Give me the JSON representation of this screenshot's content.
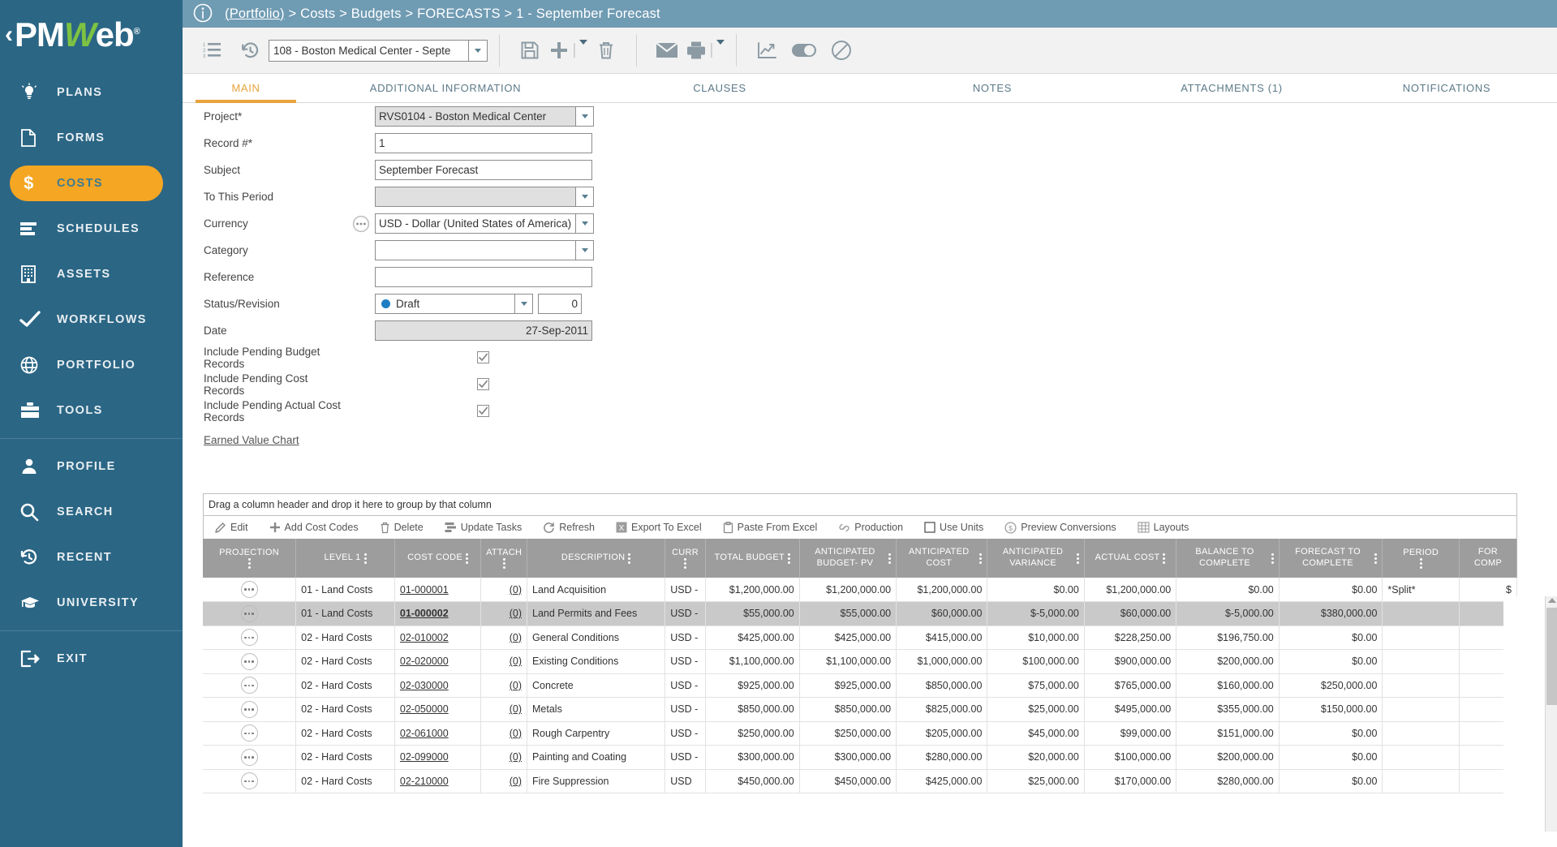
{
  "brand": {
    "chevron": "‹",
    "pm": "PM",
    "w": "W",
    "eb": "eb",
    "reg": "®"
  },
  "colors": {
    "sidebar": "#2b6685",
    "accent": "#f5a623",
    "topbar": "#6f9bb3",
    "brand_green": "#7dc242",
    "tab_active": "#e8a33d",
    "status_draft": "#1f7ec2"
  },
  "sidebar": {
    "items": [
      {
        "label": "PLANS",
        "icon": "lightbulb-icon",
        "active": false
      },
      {
        "label": "FORMS",
        "icon": "document-icon",
        "active": false
      },
      {
        "label": "COSTS",
        "icon": "dollar-icon",
        "active": true
      },
      {
        "label": "SCHEDULES",
        "icon": "bars-icon",
        "active": false
      },
      {
        "label": "ASSETS",
        "icon": "building-icon",
        "active": false
      },
      {
        "label": "WORKFLOWS",
        "icon": "checkmark-icon",
        "active": false
      },
      {
        "label": "PORTFOLIO",
        "icon": "globe-icon",
        "active": false
      },
      {
        "label": "TOOLS",
        "icon": "toolbox-icon",
        "active": false
      }
    ],
    "items2": [
      {
        "label": "PROFILE",
        "icon": "person-icon"
      },
      {
        "label": "SEARCH",
        "icon": "magnifier-icon"
      },
      {
        "label": "RECENT",
        "icon": "history-clock-icon"
      },
      {
        "label": "UNIVERSITY",
        "icon": "graduation-cap-icon"
      }
    ],
    "items3": [
      {
        "label": "EXIT",
        "icon": "exit-door-icon"
      }
    ]
  },
  "topbar": {
    "info_icon": "info-circle-icon",
    "breadcrumb_link": "(Portfolio)",
    "breadcrumb_rest": " > Costs > Budgets > FORECASTS > 1 - September Forecast"
  },
  "toolbar": {
    "list_icon": "numbered-list-icon",
    "history_icon": "history-clock-icon",
    "record_selector": "108 - Boston Medical Center - Septe",
    "save_icon": "save-disk-icon",
    "add_icon": "plus-icon",
    "add_caret": "add-dropdown-caret-icon",
    "delete_icon": "trash-icon",
    "email_icon": "envelope-icon",
    "print_icon": "printer-icon",
    "print_caret": "print-dropdown-caret-icon",
    "chart_icon": "line-chart-icon",
    "toggle_icon": "toggle-switch-icon",
    "block_icon": "no-entry-icon"
  },
  "tabs": [
    {
      "label": "MAIN",
      "active": true
    },
    {
      "label": "ADDITIONAL INFORMATION",
      "active": false
    },
    {
      "label": "CLAUSES",
      "active": false
    },
    {
      "label": "NOTES",
      "active": false
    },
    {
      "label": "ATTACHMENTS (1)",
      "active": false
    },
    {
      "label": "NOTIFICATIONS",
      "active": false
    }
  ],
  "form": {
    "project": {
      "label": "Project*",
      "value": "RVS0104 - Boston Medical Center"
    },
    "record": {
      "label": "Record #*",
      "value": "1"
    },
    "subject": {
      "label": "Subject",
      "value": "September Forecast"
    },
    "to_this_period": {
      "label": "To This Period",
      "value": ""
    },
    "currency": {
      "label": "Currency",
      "value": "USD - Dollar (United States of America)",
      "helper_icon": "ellipsis-circle-icon"
    },
    "category": {
      "label": "Category",
      "value": ""
    },
    "reference": {
      "label": "Reference",
      "value": ""
    },
    "status": {
      "label": "Status/Revision",
      "value": "Draft",
      "revision": "0"
    },
    "date": {
      "label": "Date",
      "value": "27-Sep-2011"
    },
    "chk_budget": {
      "label": "Include Pending Budget Records",
      "checked": true
    },
    "chk_cost": {
      "label": "Include Pending Cost Records",
      "checked": true
    },
    "chk_actual": {
      "label": "Include Pending Actual Cost Records",
      "checked": true
    },
    "evc_link": "Earned Value Chart",
    "check_glyph": "✓"
  },
  "grid": {
    "drag_hint": "Drag a column header and drop it here to group by that column",
    "tools": [
      {
        "label": "Edit",
        "icon": "pencil-icon"
      },
      {
        "label": "Add Cost Codes",
        "icon": "plus-icon"
      },
      {
        "label": "Delete",
        "icon": "trash-icon"
      },
      {
        "label": "Update Tasks",
        "icon": "tasks-icon"
      },
      {
        "label": "Refresh",
        "icon": "refresh-icon"
      },
      {
        "label": "Export To Excel",
        "icon": "excel-icon"
      },
      {
        "label": "Paste From Excel",
        "icon": "clipboard-icon"
      },
      {
        "label": "Production",
        "icon": "link-icon"
      },
      {
        "label": "Use Units",
        "icon": "checkbox-icon"
      },
      {
        "label": "Preview Conversions",
        "icon": "dollar-circle-icon"
      },
      {
        "label": "Layouts",
        "icon": "grid-layout-icon"
      }
    ],
    "columns": [
      "PROJECTION",
      "LEVEL 1",
      "COST CODE",
      "ATTACH",
      "DESCRIPTION",
      "CURR",
      "TOTAL BUDGET",
      "ANTICIPATED BUDGET- PV",
      "ANTICIPATED COST",
      "ANTICIPATED VARIANCE",
      "ACTUAL COST",
      "BALANCE TO COMPLETE",
      "FORECAST TO COMPLETE",
      "PERIOD",
      "FOR COMP"
    ],
    "rows": [
      {
        "projection": "⋯",
        "level1": "01 - Land Costs",
        "cost_code": "01-000001",
        "attach": "(0)",
        "description": "Land Acquisition",
        "curr": "USD -",
        "total_budget": "$1,200,000.00",
        "ant_budget_pv": "$1,200,000.00",
        "ant_cost": "$1,200,000.00",
        "ant_variance": "$0.00",
        "actual_cost": "$1,200,000.00",
        "balance_to_complete": "$0.00",
        "forecast_to_complete": "$0.00",
        "period": "*Split*",
        "for_comp": "$",
        "selected": false
      },
      {
        "projection": "⋯",
        "level1": "01 - Land Costs",
        "cost_code": "01-000002",
        "attach": "(0)",
        "description": "Land Permits and Fees",
        "curr": "USD -",
        "total_budget": "$55,000.00",
        "ant_budget_pv": "$55,000.00",
        "ant_cost": "$60,000.00",
        "ant_variance": "$-5,000.00",
        "actual_cost": "$60,000.00",
        "balance_to_complete": "$-5,000.00",
        "forecast_to_complete": "$380,000.00",
        "period": "",
        "for_comp": "",
        "selected": true
      },
      {
        "projection": "⋯",
        "level1": "02 - Hard Costs",
        "cost_code": "02-010002",
        "attach": "(0)",
        "description": "General Conditions",
        "curr": "USD -",
        "total_budget": "$425,000.00",
        "ant_budget_pv": "$425,000.00",
        "ant_cost": "$415,000.00",
        "ant_variance": "$10,000.00",
        "actual_cost": "$228,250.00",
        "balance_to_complete": "$196,750.00",
        "forecast_to_complete": "$0.00",
        "period": "",
        "for_comp": "",
        "selected": false
      },
      {
        "projection": "⋯",
        "level1": "02 - Hard Costs",
        "cost_code": "02-020000",
        "attach": "(0)",
        "description": "Existing Conditions",
        "curr": "USD -",
        "total_budget": "$1,100,000.00",
        "ant_budget_pv": "$1,100,000.00",
        "ant_cost": "$1,000,000.00",
        "ant_variance": "$100,000.00",
        "actual_cost": "$900,000.00",
        "balance_to_complete": "$200,000.00",
        "forecast_to_complete": "$0.00",
        "period": "",
        "for_comp": "$",
        "selected": false
      },
      {
        "projection": "⋯",
        "level1": "02 - Hard Costs",
        "cost_code": "02-030000",
        "attach": "(0)",
        "description": "Concrete",
        "curr": "USD -",
        "total_budget": "$925,000.00",
        "ant_budget_pv": "$925,000.00",
        "ant_cost": "$850,000.00",
        "ant_variance": "$75,000.00",
        "actual_cost": "$765,000.00",
        "balance_to_complete": "$160,000.00",
        "forecast_to_complete": "$250,000.00",
        "period": "",
        "for_comp": "",
        "selected": false
      },
      {
        "projection": "⋯",
        "level1": "02 - Hard Costs",
        "cost_code": "02-050000",
        "attach": "(0)",
        "description": "Metals",
        "curr": "USD -",
        "total_budget": "$850,000.00",
        "ant_budget_pv": "$850,000.00",
        "ant_cost": "$825,000.00",
        "ant_variance": "$25,000.00",
        "actual_cost": "$495,000.00",
        "balance_to_complete": "$355,000.00",
        "forecast_to_complete": "$150,000.00",
        "period": "",
        "for_comp": "",
        "selected": false
      },
      {
        "projection": "⋯",
        "level1": "02 - Hard Costs",
        "cost_code": "02-061000",
        "attach": "(0)",
        "description": "Rough Carpentry",
        "curr": "USD -",
        "total_budget": "$250,000.00",
        "ant_budget_pv": "$250,000.00",
        "ant_cost": "$205,000.00",
        "ant_variance": "$45,000.00",
        "actual_cost": "$99,000.00",
        "balance_to_complete": "$151,000.00",
        "forecast_to_complete": "$0.00",
        "period": "",
        "for_comp": "",
        "selected": false
      },
      {
        "projection": "⋯",
        "level1": "02 - Hard Costs",
        "cost_code": "02-099000",
        "attach": "(0)",
        "description": "Painting and Coating",
        "curr": "USD -",
        "total_budget": "$300,000.00",
        "ant_budget_pv": "$300,000.00",
        "ant_cost": "$280,000.00",
        "ant_variance": "$20,000.00",
        "actual_cost": "$100,000.00",
        "balance_to_complete": "$200,000.00",
        "forecast_to_complete": "$0.00",
        "period": "",
        "for_comp": "",
        "selected": false
      },
      {
        "projection": "⋯",
        "level1": "02 - Hard Costs",
        "cost_code": "02-210000",
        "attach": "(0)",
        "description": "Fire Suppression",
        "curr": "USD",
        "total_budget": "$450,000.00",
        "ant_budget_pv": "$450,000.00",
        "ant_cost": "$425,000.00",
        "ant_variance": "$25,000.00",
        "actual_cost": "$170,000.00",
        "balance_to_complete": "$280,000.00",
        "forecast_to_complete": "$0.00",
        "period": "",
        "for_comp": "",
        "selected": false
      }
    ]
  }
}
